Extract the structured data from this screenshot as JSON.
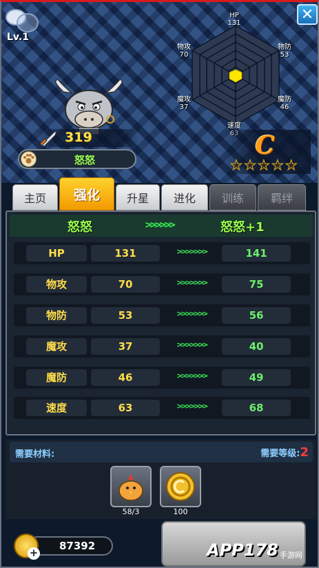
{
  "hero": {
    "level": "Lv.1",
    "power": "319",
    "name": "怒怒",
    "grade": "C",
    "stars": 5
  },
  "radar": {
    "labels": [
      {
        "name": "HP",
        "value": "131"
      },
      {
        "name": "物防",
        "value": "53"
      },
      {
        "name": "魔防",
        "value": "46"
      },
      {
        "name": "速度",
        "value": "63"
      },
      {
        "name": "魔攻",
        "value": "37"
      },
      {
        "name": "物攻",
        "value": "70"
      }
    ],
    "fill_color": "#ffe600"
  },
  "tabs": [
    "主页",
    "强化",
    "升星",
    "进化",
    "训练",
    "羁绊"
  ],
  "active_tab": "强化",
  "upgrade": {
    "from": "怒怒",
    "to": "怒怒+1",
    "arrows": ">>>>>>",
    "small_arrows": ">>>>>>>",
    "stats": [
      {
        "label": "HP",
        "current": "131",
        "next": "141"
      },
      {
        "label": "物攻",
        "current": "70",
        "next": "75"
      },
      {
        "label": "物防",
        "current": "53",
        "next": "56"
      },
      {
        "label": "魔攻",
        "current": "37",
        "next": "40"
      },
      {
        "label": "魔防",
        "current": "46",
        "next": "49"
      },
      {
        "label": "速度",
        "current": "63",
        "next": "68"
      }
    ]
  },
  "materials": {
    "title": "需要材料:",
    "req_level_label": "需要等级:",
    "req_level": "2",
    "items": [
      {
        "icon": "chick-icon",
        "count": "58/3"
      },
      {
        "icon": "gold-coin-icon",
        "count": "100"
      }
    ]
  },
  "currency": {
    "gold": "87392"
  },
  "watermark": {
    "brand": "APP178",
    "sub": "手游网"
  }
}
